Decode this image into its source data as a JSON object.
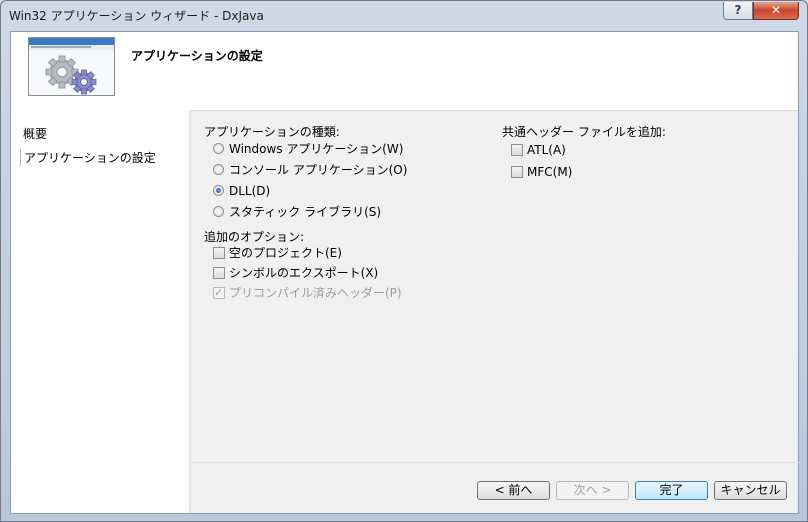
{
  "window": {
    "title": "Win32 アプリケーション ウィザード - DxJava",
    "help_label": "?",
    "close_label": "✕"
  },
  "header": {
    "title": "アプリケーションの設定"
  },
  "sidebar": {
    "items": [
      {
        "label": "概要"
      },
      {
        "label": "アプリケーションの設定"
      }
    ]
  },
  "app_type": {
    "label": "アプリケーションの種類:",
    "options": [
      {
        "label": "Windows アプリケーション(W)",
        "checked": false
      },
      {
        "label": "コンソール アプリケーション(O)",
        "checked": false
      },
      {
        "label": "DLL(D)",
        "checked": true
      },
      {
        "label": "スタティック ライブラリ(S)",
        "checked": false
      }
    ]
  },
  "additional": {
    "label": "追加のオプション:",
    "options": [
      {
        "label": "空のプロジェクト(E)",
        "checked": false,
        "enabled": true
      },
      {
        "label": "シンボルのエクスポート(X)",
        "checked": false,
        "enabled": true
      },
      {
        "label": "プリコンパイル済みヘッダー(P)",
        "checked": true,
        "enabled": false
      }
    ]
  },
  "common_headers": {
    "label": "共通ヘッダー ファイルを追加:",
    "options": [
      {
        "label": "ATL(A)",
        "checked": false
      },
      {
        "label": "MFC(M)",
        "checked": false
      }
    ]
  },
  "buttons": {
    "prev": "< 前へ",
    "next": "次へ >",
    "finish": "完了",
    "cancel": "キャンセル"
  },
  "colors": {
    "accent": "#3c7fb1",
    "close": "#c8442a"
  }
}
